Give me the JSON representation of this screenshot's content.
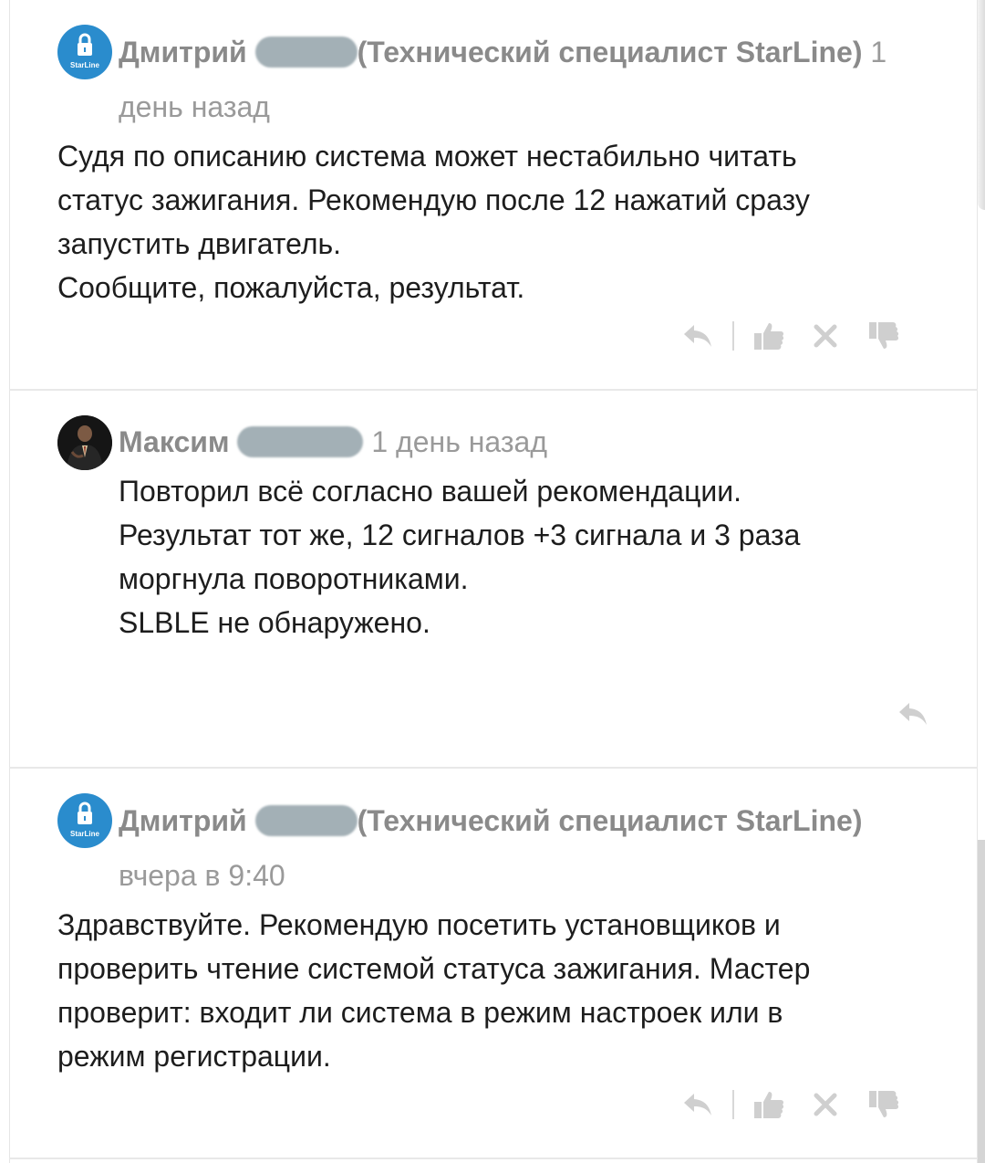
{
  "comments": [
    {
      "author": "Дмитрий",
      "role": "(Технический специалист StarLine)",
      "date_part1": "1",
      "date_part2": "день назад",
      "text": "Судя по описанию система может нестабильно читать\nстатус зажигания. Рекомендую после 12 нажатий сразу\nзапустить двигатель.\nСообщите, пожалуйста, результат.",
      "avatar_label": "StarLine"
    },
    {
      "author": "Максим",
      "date": "1 день назад",
      "text": "Повторил всё согласно вашей рекомендации.\nРезультат тот же, 12 сигналов +3 сигнала и 3 раза\nморгнула поворотниками.\nSLBLE не обнаружено."
    },
    {
      "author": "Дмитрий",
      "role": "(Технический специалист StarLine)",
      "date": "вчера в 9:40",
      "text": "Здравствуйте. Рекомендую посетить установщиков и\nпроверить чтение системой статуса зажигания. Мастер\nпроверит: входит ли система в режим настроек или в\nрежим регистрации.",
      "avatar_label": "StarLine"
    }
  ],
  "icons": {
    "reply": "reply-icon",
    "like": "thumbs-up-icon",
    "delete": "close-icon",
    "dislike": "thumbs-down-icon"
  },
  "colors": {
    "starline_blue": "#2a8ccd",
    "icon_gray": "#cfcfcf",
    "text": "#1d1d1d",
    "meta": "#8b8b8b"
  }
}
